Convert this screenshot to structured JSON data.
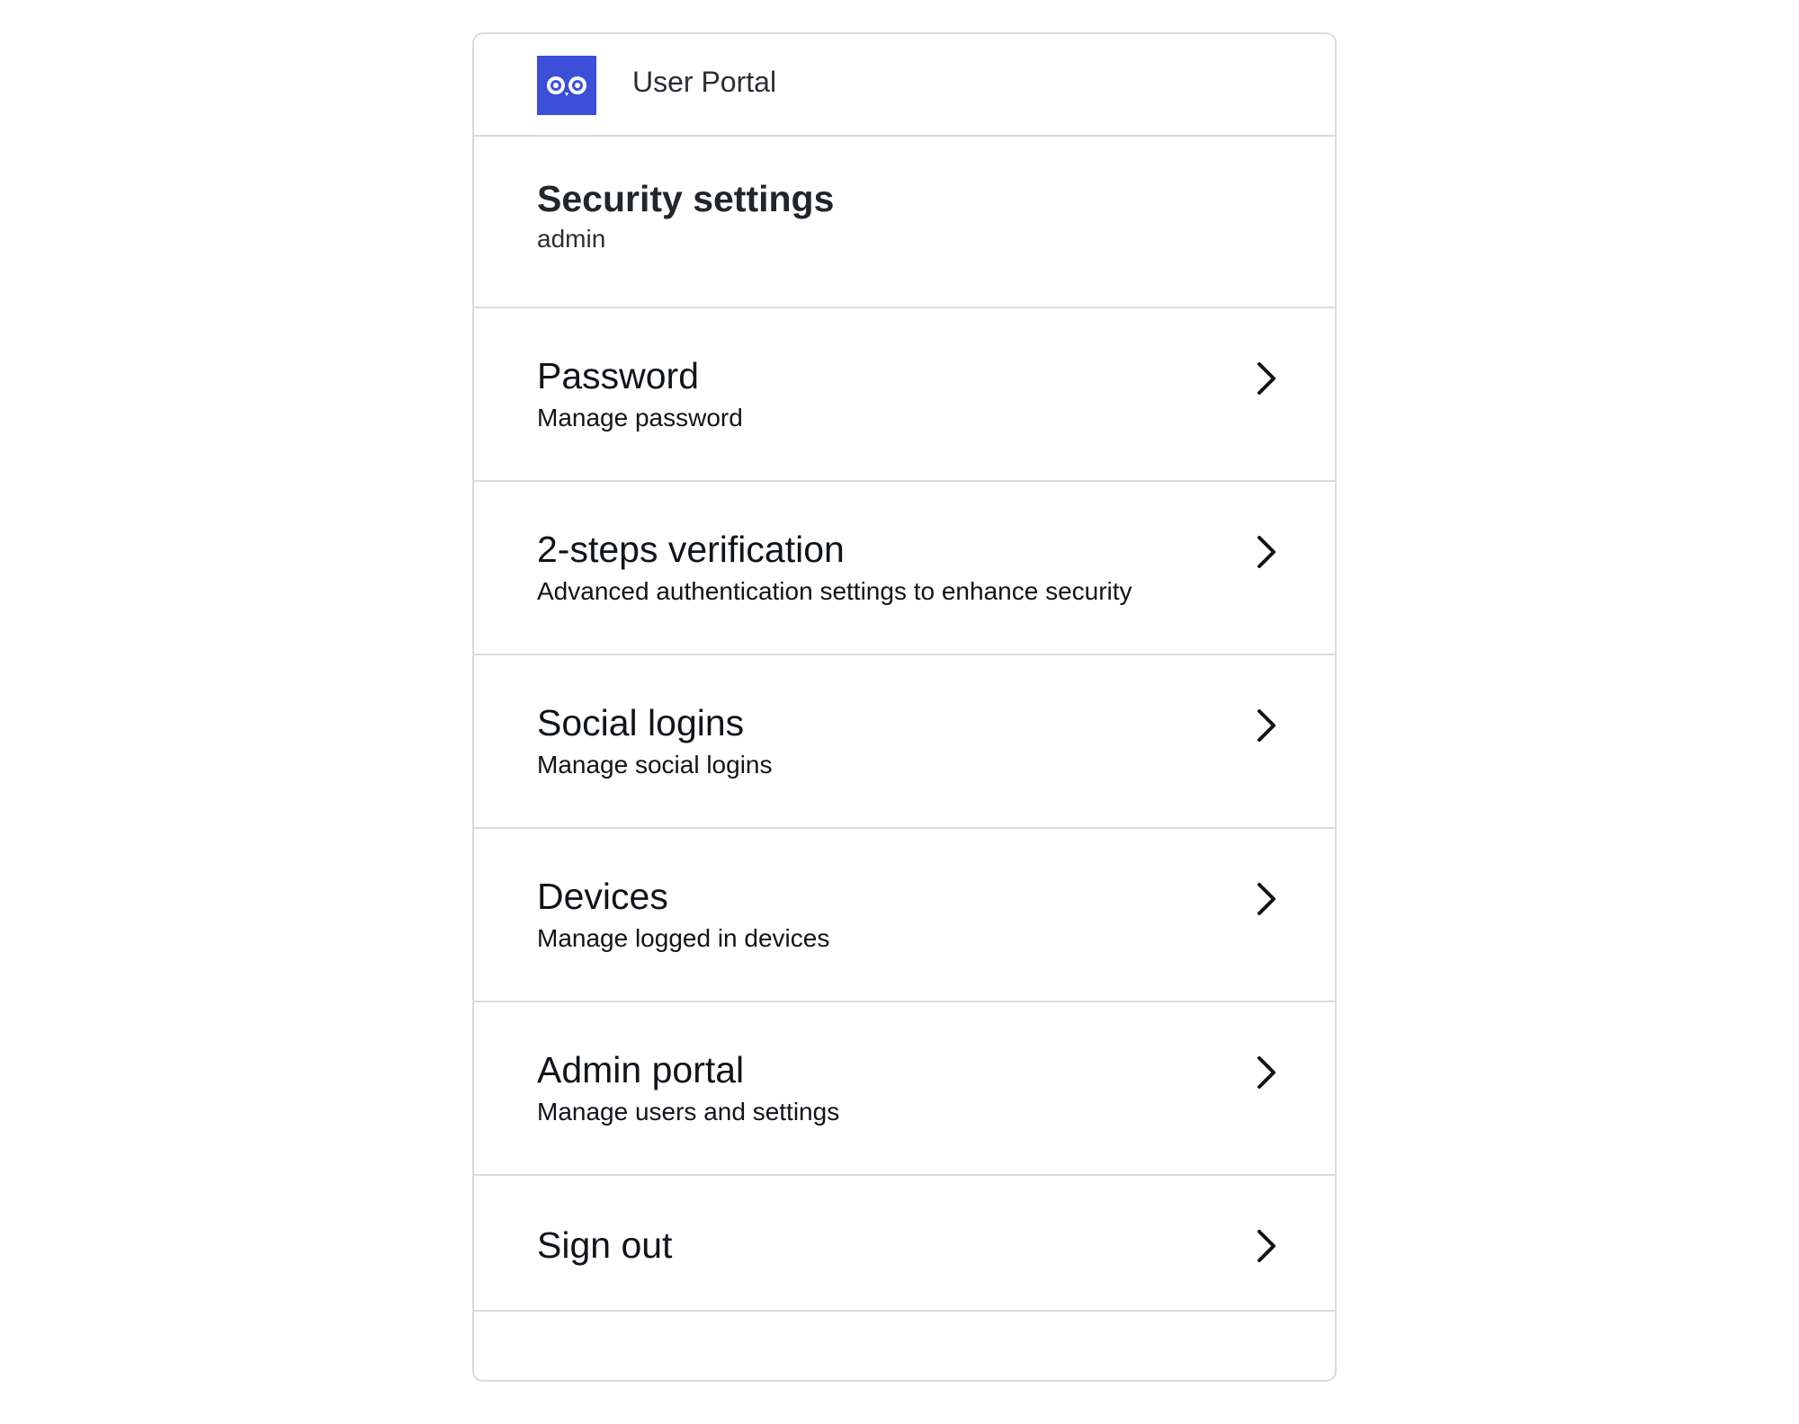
{
  "header": {
    "logo_icon": "owl-logo-icon",
    "brand_color": "#3b4fd8",
    "app_title": "User Portal"
  },
  "page": {
    "title": "Security settings",
    "username": "admin"
  },
  "menu": {
    "items": [
      {
        "title": "Password",
        "subtitle": "Manage password",
        "icon": "chevron-right-icon"
      },
      {
        "title": "2-steps verification",
        "subtitle": "Advanced authentication settings to enhance security",
        "icon": "chevron-right-icon"
      },
      {
        "title": "Social logins",
        "subtitle": "Manage social logins",
        "icon": "chevron-right-icon"
      },
      {
        "title": "Devices",
        "subtitle": "Manage logged in devices",
        "icon": "chevron-right-icon"
      },
      {
        "title": "Admin portal",
        "subtitle": "Manage users and settings",
        "icon": "chevron-right-icon"
      },
      {
        "title": "Sign out",
        "icon": "chevron-right-icon"
      }
    ]
  }
}
